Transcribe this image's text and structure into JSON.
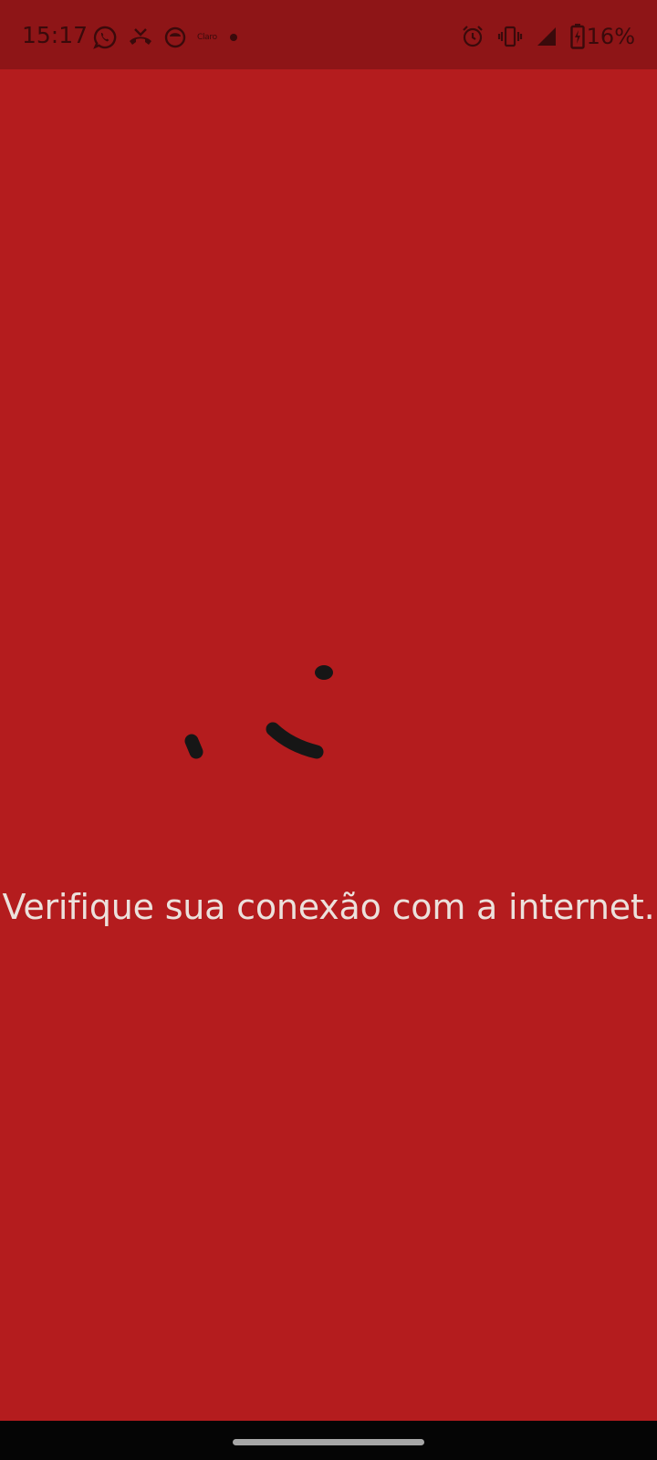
{
  "status_bar": {
    "time": "15:17",
    "carrier_label": "Claro",
    "battery_percent": "16%",
    "left_icons": [
      "whatsapp-icon",
      "missed-call-icon",
      "app-notification-icon",
      "carrier-icon",
      "dot-icon"
    ],
    "right_icons": [
      "alarm-icon",
      "vibrate-icon",
      "signal-icon",
      "battery-charging-icon"
    ],
    "background_color": "#8e1517"
  },
  "main": {
    "background_color": "#b41c1e",
    "loading_indicator": "loading-spinner-icon",
    "message": "Verifique sua conexão com a internet."
  },
  "navigation_bar": {
    "background_color": "#050505",
    "handle": "home-indicator"
  }
}
